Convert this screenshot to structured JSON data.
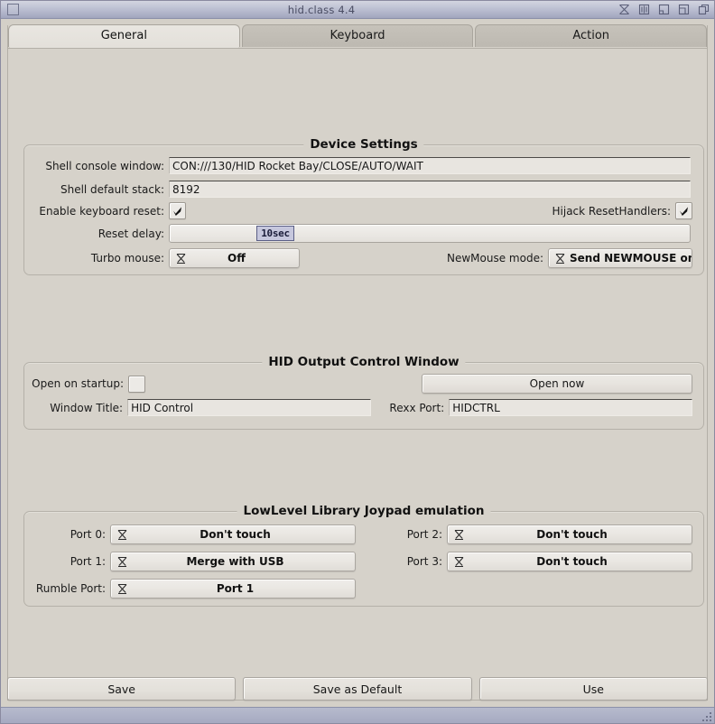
{
  "window": {
    "title": "hid.class 4.4",
    "left_gadget": "window-close-gadget",
    "right_gadgets": [
      {
        "name": "snapshot-icon",
        "glyph": "hourglass"
      },
      {
        "name": "iconify-icon",
        "glyph": "iconify"
      },
      {
        "name": "zoom-icon",
        "glyph": "zoom"
      },
      {
        "name": "depth-icon",
        "glyph": "depth"
      },
      {
        "name": "cycle-window-icon",
        "glyph": "cycle"
      }
    ]
  },
  "tabs": [
    {
      "label": "General",
      "active": true
    },
    {
      "label": "Keyboard",
      "active": false
    },
    {
      "label": "Action",
      "active": false
    }
  ],
  "device_settings": {
    "title": "Device Settings",
    "shell_console_label": "Shell console window:",
    "shell_console_value": "CON:///130/HID Rocket Bay/CLOSE/AUTO/WAIT",
    "shell_stack_label": "Shell default stack:",
    "shell_stack_value": "8192",
    "enable_keyboard_reset_label": "Enable keyboard reset:",
    "enable_keyboard_reset_checked": true,
    "hijack_resethandlers_label": "Hijack ResetHandlers:",
    "hijack_resethandlers_checked": true,
    "reset_delay_label": "Reset delay:",
    "reset_delay_value": "10sec",
    "turbo_mouse_label": "Turbo mouse:",
    "turbo_mouse_value": "Off",
    "newmouse_mode_label": "NewMouse mode:",
    "newmouse_mode_value": "Send NEWMOUSE only"
  },
  "hid_output": {
    "title": "HID Output Control Window",
    "open_on_startup_label": "Open on startup:",
    "open_on_startup_checked": false,
    "open_now_label": "Open now",
    "window_title_label": "Window Title:",
    "window_title_value": "HID Control",
    "rexx_port_label": "Rexx Port:",
    "rexx_port_value": "HIDCTRL"
  },
  "joypad": {
    "title": "LowLevel Library Joypad emulation",
    "port0_label": "Port 0:",
    "port0_value": "Don't touch",
    "port1_label": "Port 1:",
    "port1_value": "Merge with USB",
    "rumble_label": "Rumble Port:",
    "rumble_value": "Port 1",
    "port2_label": "Port 2:",
    "port2_value": "Don't touch",
    "port3_label": "Port 3:",
    "port3_value": "Don't touch"
  },
  "footer": {
    "save_label": "Save",
    "save_default_label": "Save as Default",
    "use_label": "Use"
  },
  "colors": {
    "window_bg": "#d4d0c8",
    "page_bg": "#d6d2ca",
    "titlebar": "#b4b8cc",
    "string_bg": "#e8e5e0",
    "knob": "#c6c7dd",
    "knob_border": "#5b5f86"
  }
}
